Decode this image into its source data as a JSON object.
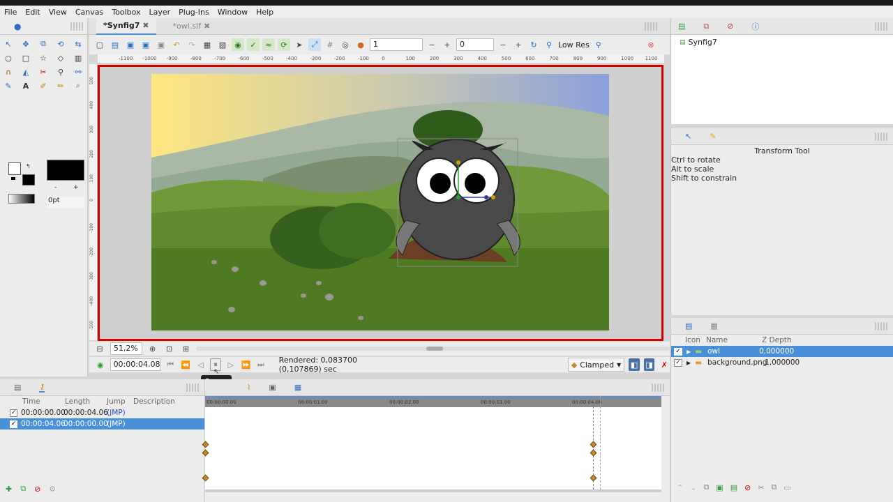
{
  "menubar": [
    "File",
    "Edit",
    "View",
    "Canvas",
    "Toolbox",
    "Layer",
    "Plug-Ins",
    "Window",
    "Help"
  ],
  "tabs": [
    {
      "label": "*Synfig7",
      "close": "✖"
    },
    {
      "label": "*owl.sif",
      "close": "✖"
    }
  ],
  "toolbar": {
    "frame_start": "1",
    "frame_end": "0",
    "res_label": "Low Res"
  },
  "ruler_h": [
    "-1100",
    "-1000",
    "-900",
    "-800",
    "-700",
    "-600",
    "-500",
    "-400",
    "-300",
    "-200",
    "-100",
    "0",
    "100",
    "200",
    "300",
    "400",
    "500",
    "600",
    "700",
    "800",
    "900",
    "1000",
    "1100"
  ],
  "ruler_v": [
    "500",
    "400",
    "300",
    "200",
    "100",
    "0",
    "-100",
    "-200",
    "-300",
    "-400",
    "-500"
  ],
  "zoom": "51,2%",
  "time": "00:00:04.08",
  "render_status": "Rendered: 0,083700 (0,107869) sec",
  "interpolation": "Clamped",
  "tooltip": "Pause",
  "outline_width": "0pt",
  "canvas_browser": {
    "item": "Synfig7"
  },
  "tool_options": {
    "title": "Transform Tool",
    "hints": [
      "Ctrl to rotate",
      "Alt to scale",
      "Shift to constrain"
    ]
  },
  "layers": {
    "headers": [
      "Icon",
      "Name",
      "Z Depth"
    ],
    "rows": [
      {
        "name": "owl",
        "z": "0,000000",
        "selected": true
      },
      {
        "name": "background.png",
        "z": "1,000000",
        "selected": false
      }
    ]
  },
  "keyframes": {
    "headers": [
      "Time",
      "Length",
      "Jump",
      "Description"
    ],
    "rows": [
      {
        "time": "00:00:00.00",
        "length": "00:00:04.06",
        "jump": "(JMP)",
        "selected": false
      },
      {
        "time": "00:00:04.06",
        "length": "00:00:00.00",
        "jump": "(JMP)",
        "selected": true
      }
    ]
  },
  "timeline_ticks": [
    "00:00:00.00",
    "00:00:01.00",
    "00:00:02.00",
    "00:00:03.00",
    "00:00:04.00"
  ],
  "colors": {
    "accent": "#4a90d9",
    "frame_border": "#d40000",
    "keyframe": "#c98a2a"
  }
}
